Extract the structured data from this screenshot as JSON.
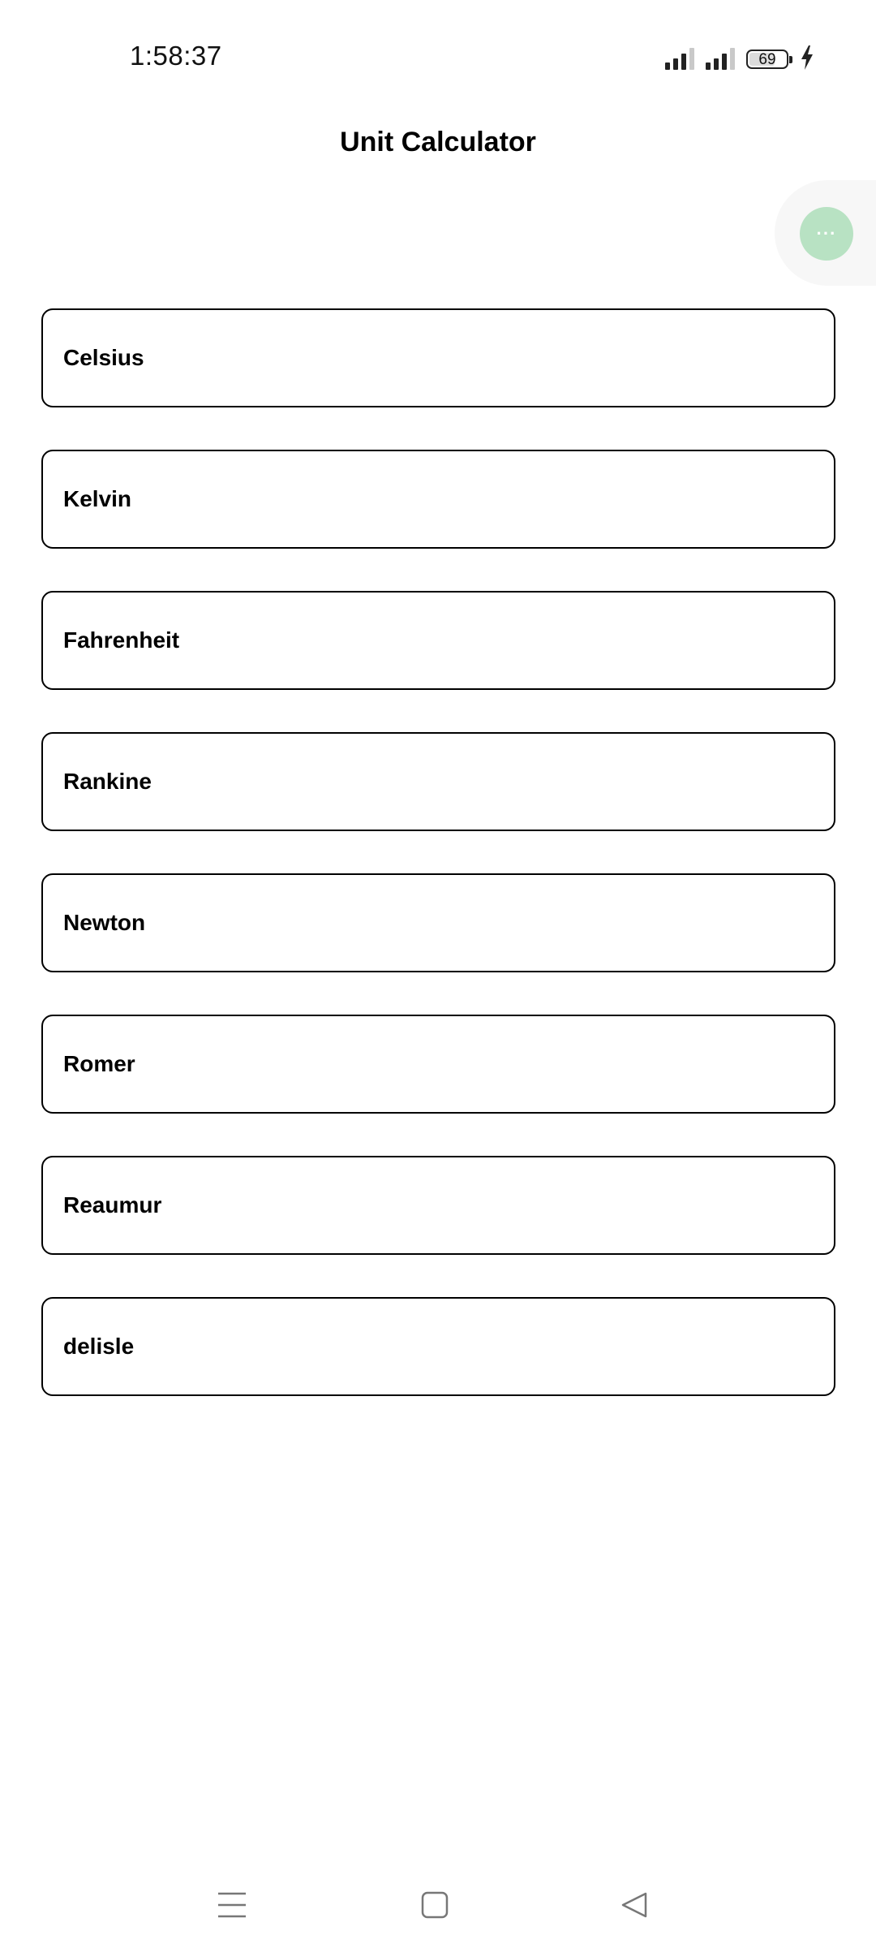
{
  "status_bar": {
    "time": "1:58:37",
    "battery_level": "69",
    "charging": true,
    "signal_icons": [
      "cellular-signal-icon",
      "cellular-signal-icon"
    ]
  },
  "header": {
    "title": "Unit Calculator"
  },
  "fab": {
    "label": "···",
    "icon": "more-icon",
    "color": "#b8e2c3"
  },
  "units": [
    {
      "label": "Celsius"
    },
    {
      "label": "Kelvin"
    },
    {
      "label": "Fahrenheit"
    },
    {
      "label": "Rankine"
    },
    {
      "label": "Newton"
    },
    {
      "label": "Romer"
    },
    {
      "label": "Reaumur"
    },
    {
      "label": "delisle"
    }
  ],
  "nav_bar": {
    "icons": [
      "menu-icon",
      "home-icon",
      "back-icon"
    ]
  }
}
